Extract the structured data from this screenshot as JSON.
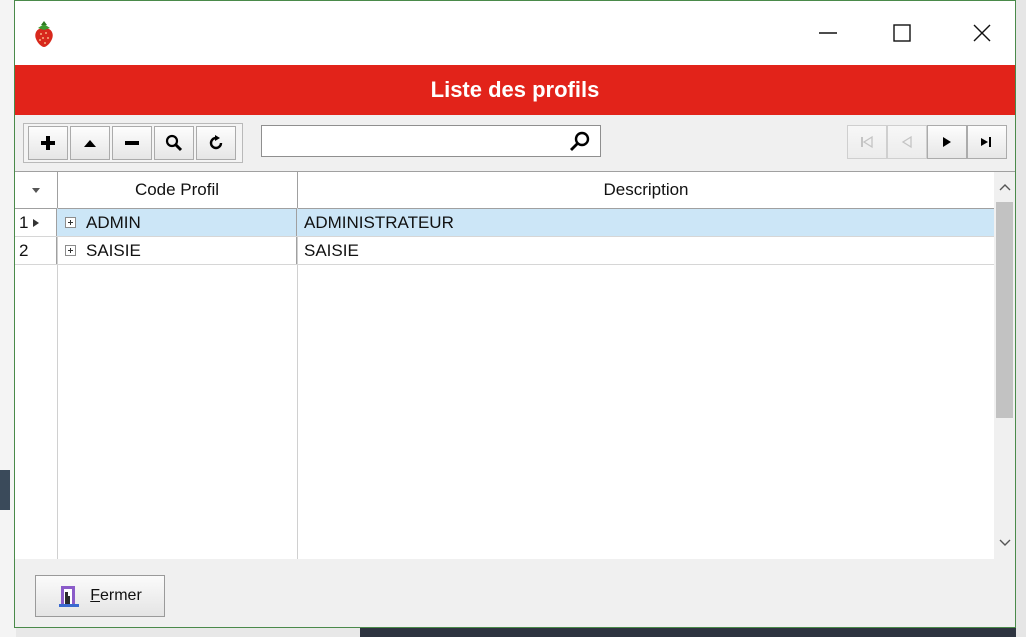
{
  "window": {
    "title": "Liste des profils",
    "accent_color": "#e2231a",
    "controls": {
      "minimize": "minimize-icon",
      "maximize": "maximize-icon",
      "close": "close-icon"
    }
  },
  "toolbar": {
    "buttons": [
      "add-icon",
      "move-up-icon",
      "remove-icon",
      "zoom-icon",
      "refresh-icon"
    ],
    "search": {
      "value": "",
      "placeholder": ""
    },
    "nav": [
      "first-record-icon",
      "previous-record-icon",
      "next-record-icon",
      "last-record-icon"
    ]
  },
  "grid": {
    "columns": [
      "Code Profil",
      "Description"
    ],
    "rows": [
      {
        "index": "1",
        "code": "ADMIN",
        "description": "ADMINISTRATEUR",
        "selected": true
      },
      {
        "index": "2",
        "code": "SAISIE",
        "description": "SAISIE",
        "selected": false
      }
    ]
  },
  "footer": {
    "close_first_letter": "F",
    "close_rest": "ermer"
  }
}
